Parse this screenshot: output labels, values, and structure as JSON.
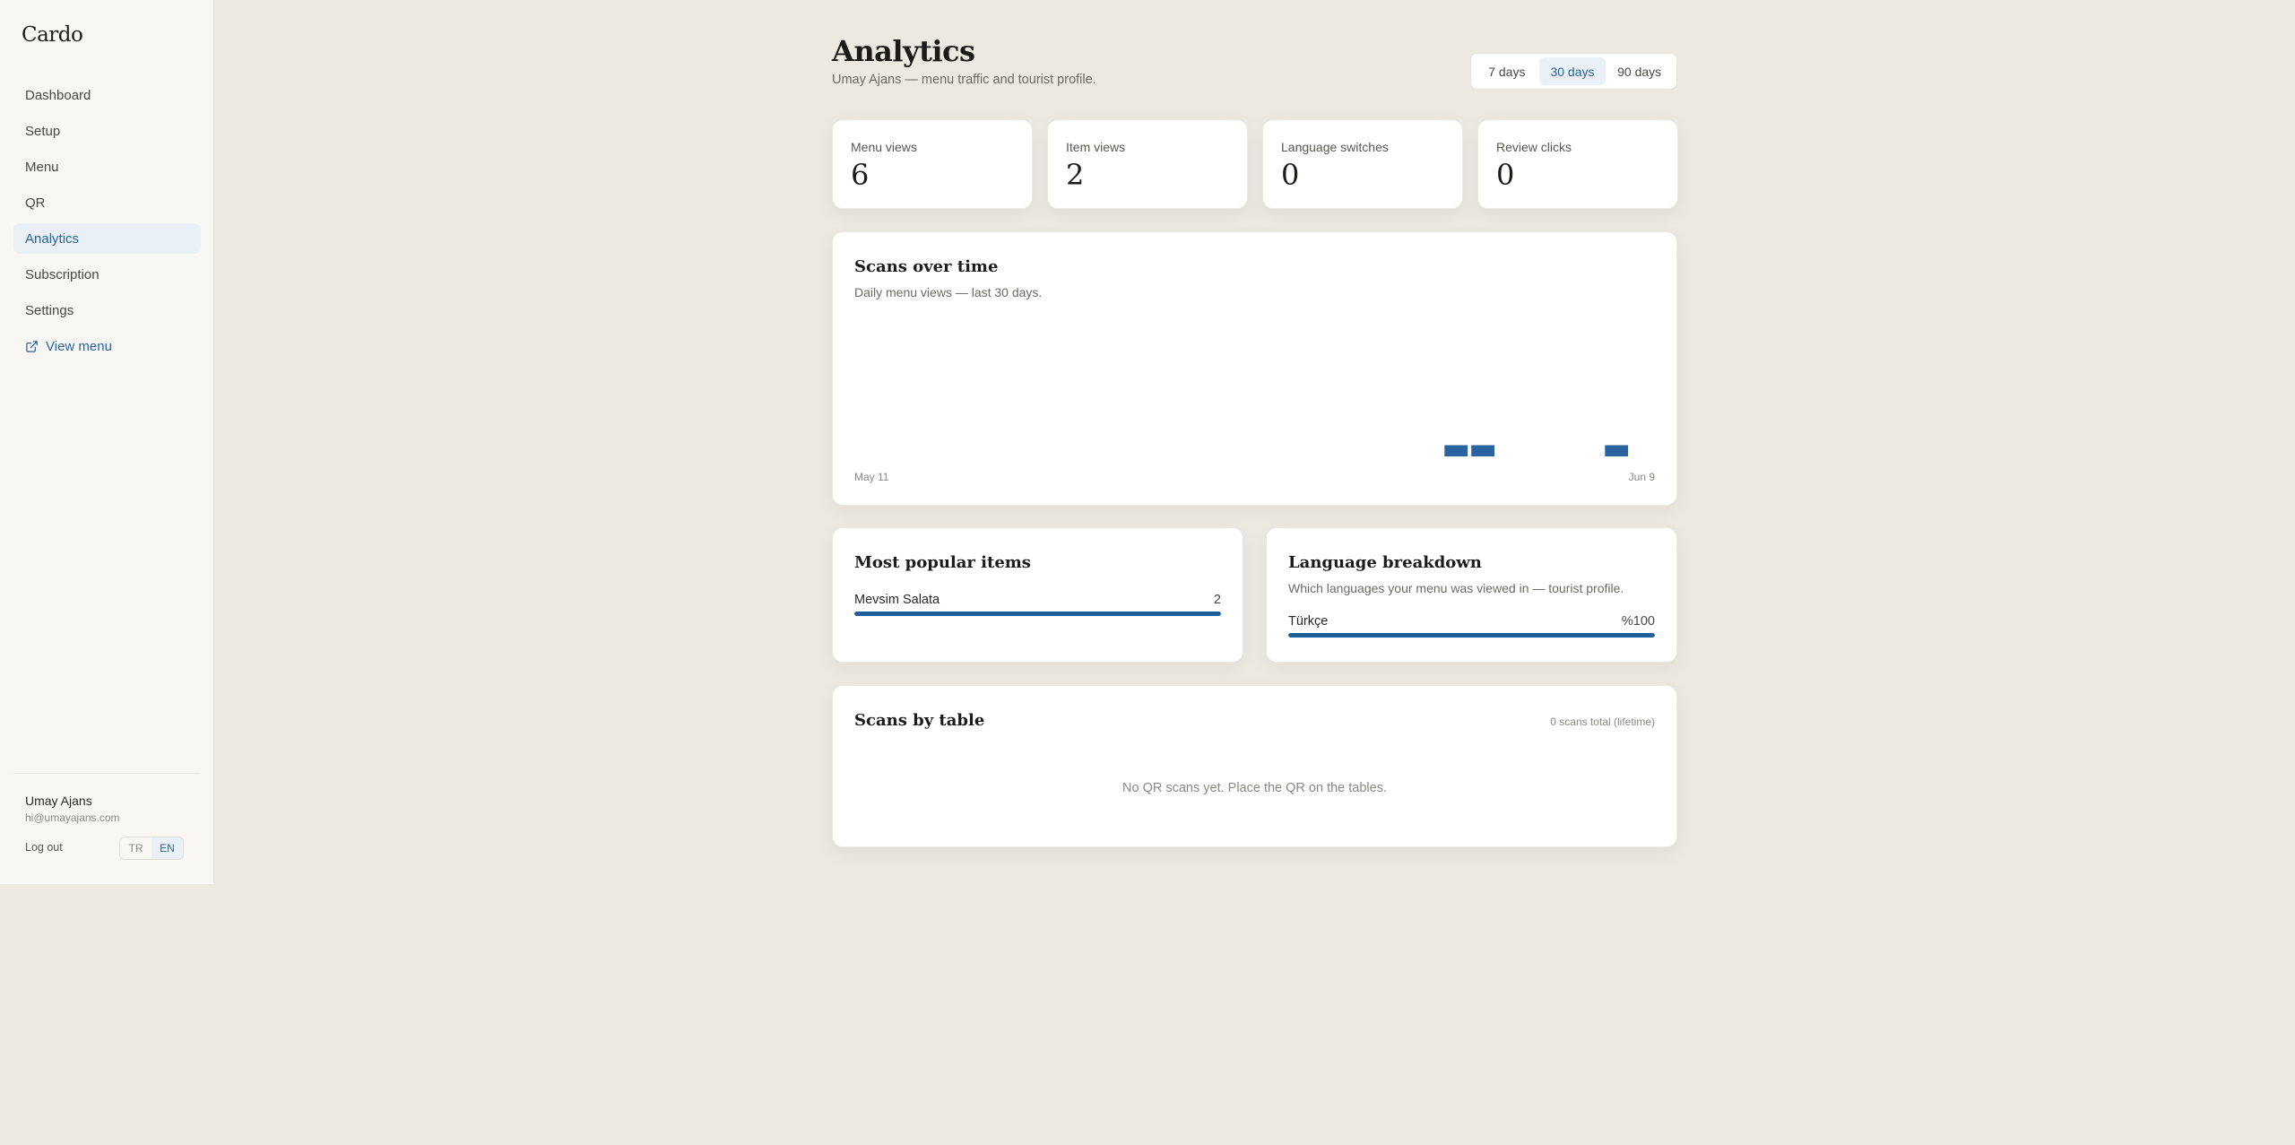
{
  "app": {
    "name": "Cardo"
  },
  "sidebar": {
    "items": [
      {
        "label": "Dashboard"
      },
      {
        "label": "Setup"
      },
      {
        "label": "Menu"
      },
      {
        "label": "QR"
      },
      {
        "label": "Analytics",
        "active": true
      },
      {
        "label": "Subscription"
      },
      {
        "label": "Settings"
      }
    ],
    "view_menu": {
      "label": "View menu",
      "icon": "external-link-icon"
    },
    "user": {
      "name": "Umay Ajans",
      "email": "hi@umayajans.com"
    },
    "logout_label": "Log out",
    "languages": [
      {
        "code": "TR"
      },
      {
        "code": "EN",
        "active": true
      }
    ]
  },
  "header": {
    "title": "Analytics",
    "subtitle": "Umay Ajans — menu traffic and tourist profile."
  },
  "range": {
    "options": [
      {
        "label": "7 days"
      },
      {
        "label": "30 days",
        "active": true
      },
      {
        "label": "90 days"
      }
    ]
  },
  "stats": [
    {
      "label": "Menu views",
      "value": "6"
    },
    {
      "label": "Item views",
      "value": "2"
    },
    {
      "label": "Language switches",
      "value": "0"
    },
    {
      "label": "Review clicks",
      "value": "0"
    }
  ],
  "scans_chart": {
    "title": "Scans over time",
    "subtitle": "Daily menu views — last 30 days.",
    "start_label": "May 11",
    "end_label": "Jun 9"
  },
  "chart_data": {
    "type": "bar",
    "title": "Scans over time",
    "x": [
      "May 11",
      "May 12",
      "May 13",
      "May 14",
      "May 15",
      "May 16",
      "May 17",
      "May 18",
      "May 19",
      "May 20",
      "May 21",
      "May 22",
      "May 23",
      "May 24",
      "May 25",
      "May 26",
      "May 27",
      "May 28",
      "May 29",
      "May 30",
      "May 31",
      "Jun 1",
      "Jun 2",
      "Jun 3",
      "Jun 4",
      "Jun 5",
      "Jun 6",
      "Jun 7",
      "Jun 8",
      "Jun 9"
    ],
    "values": [
      0,
      0,
      0,
      0,
      0,
      0,
      0,
      0,
      0,
      0,
      0,
      0,
      0,
      0,
      0,
      0,
      0,
      0,
      0,
      0,
      0,
      0,
      2,
      2,
      0,
      0,
      0,
      0,
      2,
      0
    ],
    "color": "#2a64a0"
  },
  "popular": {
    "title": "Most popular items",
    "items": [
      {
        "name": "Mevsim Salata",
        "count": "2",
        "fraction": 1.0
      }
    ]
  },
  "language_breakdown": {
    "title": "Language breakdown",
    "subtitle": "Which languages your menu was viewed in — tourist profile.",
    "items": [
      {
        "name": "Türkçe",
        "percent_label": "%100",
        "fraction": 1.0
      }
    ]
  },
  "scans_by_table": {
    "title": "Scans by table",
    "meta": "0 scans total (lifetime)",
    "empty": "No QR scans yet. Place the QR on the tables."
  },
  "colors": {
    "accent": "#2a64a0",
    "bar": "#1f5f9a",
    "background": "#ece9e1"
  }
}
